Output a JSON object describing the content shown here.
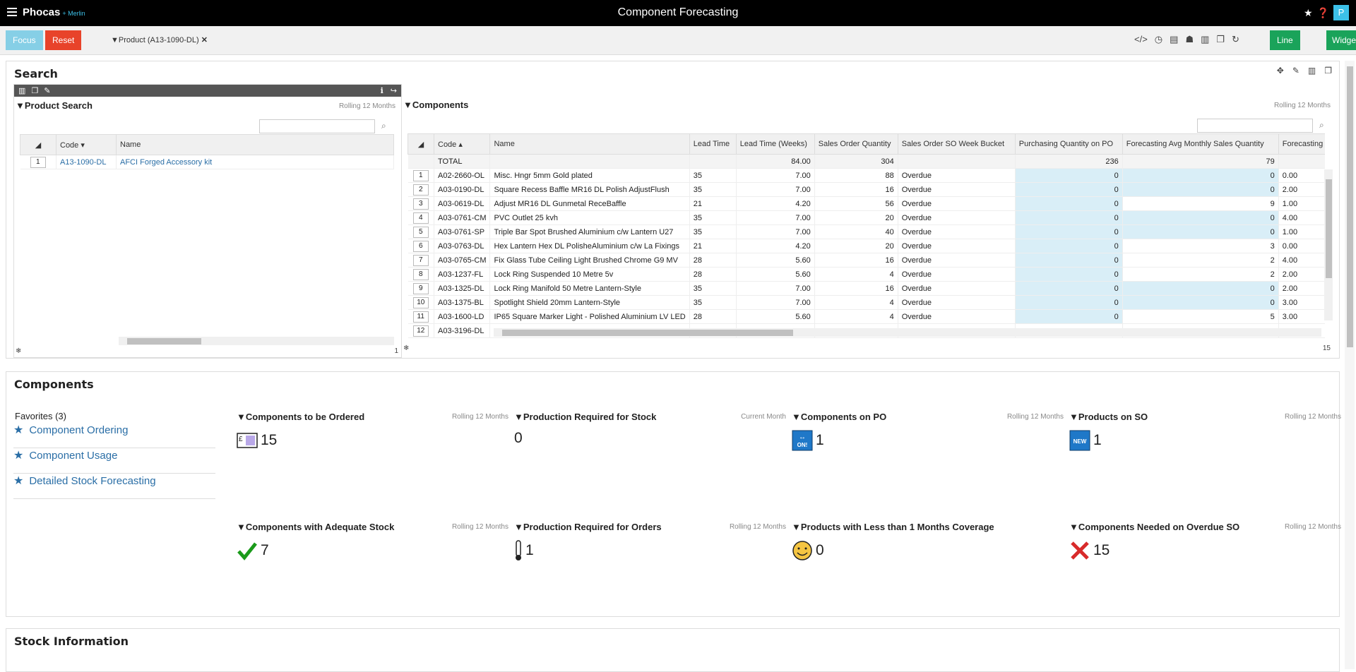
{
  "app": {
    "logo": "Phocas",
    "logo_sub": "+ Merlin",
    "title": "Component Forecasting",
    "avatar": "P"
  },
  "toolbar": {
    "focus": "Focus",
    "reset": "Reset",
    "filter": "Product (A13-1090-DL)",
    "line": "Line",
    "widget": "Widget"
  },
  "search_section": {
    "title": "Search"
  },
  "product_search": {
    "title": "Product Search",
    "period": "Rolling 12 Months",
    "headers": [
      "Code",
      "Name"
    ],
    "rows": [
      {
        "n": "1",
        "code": "A13-1090-DL",
        "name": "AFCI Forged Accessory kit"
      }
    ],
    "count": "1"
  },
  "components": {
    "title": "Components",
    "period": "Rolling 12 Months",
    "headers": [
      "Code",
      "Name",
      "Lead Time",
      "Lead Time (Weeks)",
      "Sales Order Quantity",
      "Sales Order SO Week Bucket",
      "Purchasing Quantity on PO",
      "Forecasting Avg Monthly Sales Quantity",
      "Forecasting Qu"
    ],
    "total": {
      "label": "TOTAL",
      "weeks": "84.00",
      "soq": "304",
      "po": "236",
      "avg": "79"
    },
    "rows": [
      {
        "n": "1",
        "code": "A02-2660-OL",
        "name": "Misc. Hngr 5mm Gold plated",
        "lt": "35",
        "ltw": "7.00",
        "soq": "88",
        "bucket": "Overdue",
        "po": "0",
        "avg": "0",
        "fq": "0.00",
        "avgblue": true
      },
      {
        "n": "2",
        "code": "A03-0190-DL",
        "name": "Square Recess Baffle MR16 DL Polish AdjustFlush",
        "lt": "35",
        "ltw": "7.00",
        "soq": "16",
        "bucket": "Overdue",
        "po": "0",
        "avg": "0",
        "fq": "2.00",
        "avgblue": true
      },
      {
        "n": "3",
        "code": "A03-0619-DL",
        "name": "Adjust MR16 DL Gunmetal ReceBaffle",
        "lt": "21",
        "ltw": "4.20",
        "soq": "56",
        "bucket": "Overdue",
        "po": "0",
        "avg": "9",
        "fq": "1.00",
        "avgblue": false
      },
      {
        "n": "4",
        "code": "A03-0761-CM",
        "name": "PVC Outlet 25 kvh",
        "lt": "35",
        "ltw": "7.00",
        "soq": "20",
        "bucket": "Overdue",
        "po": "0",
        "avg": "0",
        "fq": "4.00",
        "avgblue": true
      },
      {
        "n": "5",
        "code": "A03-0761-SP",
        "name": "Triple Bar Spot Brushed Aluminium c/w Lantern U27",
        "lt": "35",
        "ltw": "7.00",
        "soq": "40",
        "bucket": "Overdue",
        "po": "0",
        "avg": "0",
        "fq": "1.00",
        "avgblue": true
      },
      {
        "n": "6",
        "code": "A03-0763-DL",
        "name": "Hex Lantern Hex DL PolisheAluminium c/w La Fixings",
        "lt": "21",
        "ltw": "4.20",
        "soq": "20",
        "bucket": "Overdue",
        "po": "0",
        "avg": "3",
        "fq": "0.00",
        "avgblue": false
      },
      {
        "n": "7",
        "code": "A03-0765-CM",
        "name": "Fix Glass Tube Ceiling Light Brushed Chrome G9 MV",
        "lt": "28",
        "ltw": "5.60",
        "soq": "16",
        "bucket": "Overdue",
        "po": "0",
        "avg": "2",
        "fq": "4.00",
        "avgblue": false
      },
      {
        "n": "8",
        "code": "A03-1237-FL",
        "name": "Lock Ring Suspended 10 Metre 5v",
        "lt": "28",
        "ltw": "5.60",
        "soq": "4",
        "bucket": "Overdue",
        "po": "0",
        "avg": "2",
        "fq": "2.00",
        "avgblue": false
      },
      {
        "n": "9",
        "code": "A03-1325-DL",
        "name": "Lock Ring Manifold 50 Metre Lantern-Style",
        "lt": "35",
        "ltw": "7.00",
        "soq": "16",
        "bucket": "Overdue",
        "po": "0",
        "avg": "0",
        "fq": "2.00",
        "avgblue": true
      },
      {
        "n": "10",
        "code": "A03-1375-BL",
        "name": "Spotlight Shield 20mm Lantern-Style",
        "lt": "35",
        "ltw": "7.00",
        "soq": "4",
        "bucket": "Overdue",
        "po": "0",
        "avg": "0",
        "fq": "3.00",
        "avgblue": true
      },
      {
        "n": "11",
        "code": "A03-1600-LD",
        "name": "IP65 Square Marker Light - Polished Aluminium LV LED",
        "lt": "28",
        "ltw": "5.60",
        "soq": "4",
        "bucket": "Overdue",
        "po": "0",
        "avg": "5",
        "fq": "3.00",
        "avgblue": false
      },
      {
        "n": "12",
        "code": "A03-3196-DL",
        "name": "",
        "lt": "",
        "ltw": "",
        "soq": "",
        "bucket": "",
        "po": "",
        "avg": "",
        "fq": "",
        "avgblue": false
      }
    ],
    "count": "15"
  },
  "components_section": {
    "title": "Components",
    "favorites_title": "Favorites (3)",
    "favorites": [
      "Component Ordering",
      "Component Usage",
      "Detailed Stock Forecasting"
    ],
    "kpis": [
      {
        "title": "Components to be Ordered",
        "period": "Rolling 12 Months",
        "value": "15",
        "icon": "order-form-icon"
      },
      {
        "title": "Production Required for Stock",
        "period": "Current Month",
        "value": "0",
        "icon": ""
      },
      {
        "title": "Components on PO",
        "period": "Rolling 12 Months",
        "value": "1",
        "icon": "on-po-icon"
      },
      {
        "title": "Products on SO",
        "period": "Rolling 12 Months",
        "value": "1",
        "icon": "new-badge-icon"
      },
      {
        "title": "Components with Adequate Stock",
        "period": "Rolling 12 Months",
        "value": "7",
        "icon": "check-icon"
      },
      {
        "title": "Production Required for Orders",
        "period": "Rolling 12 Months",
        "value": "1",
        "icon": "thermometer-icon"
      },
      {
        "title": "Products with Less than 1 Months Coverage",
        "period": "",
        "value": "0",
        "icon": "smiley-icon"
      },
      {
        "title": "Components Needed on Overdue SO",
        "period": "Rolling 12 Months",
        "value": "15",
        "icon": "cross-icon"
      }
    ]
  },
  "stock_section": {
    "title": "Stock Information"
  },
  "colors": {
    "accent": "#1aa35a",
    "focus": "#86cfe6",
    "reset": "#e8432a",
    "link": "#2a6ea6",
    "highlight": "#d9eef7"
  }
}
